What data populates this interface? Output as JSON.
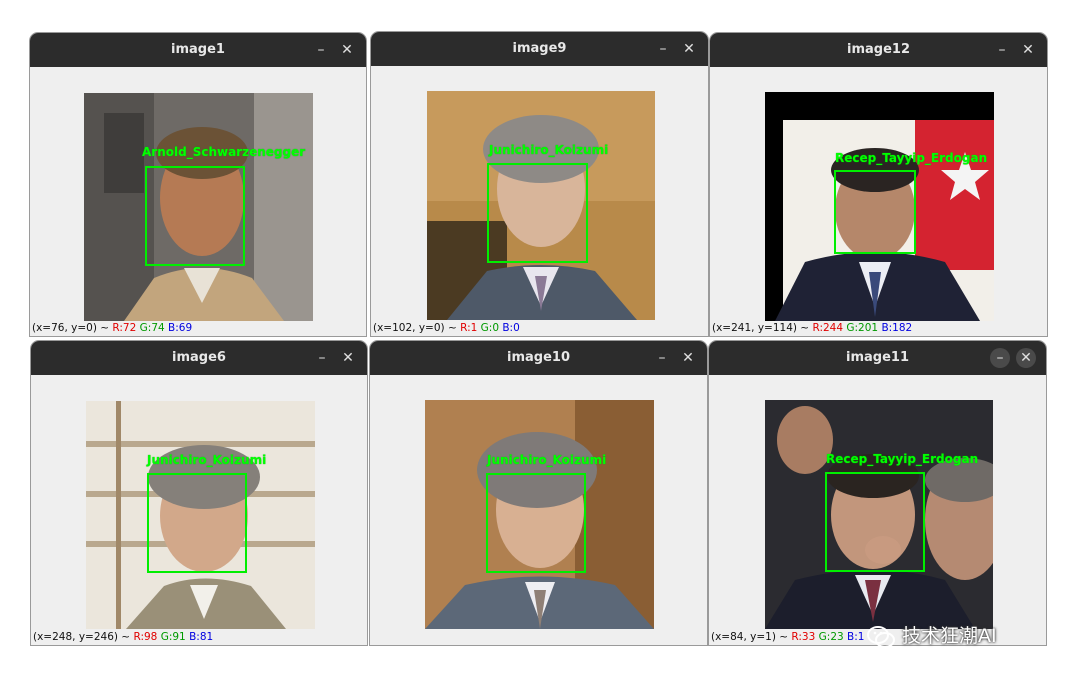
{
  "windows": [
    {
      "title": "image1",
      "name_label": "Arnold_Schwarzenegger",
      "status": {
        "coords": "(x=76, y=0) ~",
        "r": "R:72",
        "g": "G:74",
        "b": "B:69"
      }
    },
    {
      "title": "image9",
      "name_label": "Junichiro_Koizumi",
      "status": {
        "coords": "(x=102, y=0) ~",
        "r": "R:1",
        "g": "G:0",
        "b": "B:0"
      }
    },
    {
      "title": "image12",
      "name_label": "Recep_Tayyip_Erdogan",
      "status": {
        "coords": "(x=241, y=114) ~",
        "r": "R:244",
        "g": "G:201",
        "b": "B:182"
      }
    },
    {
      "title": "image6",
      "name_label": "Junichiro_Koizumi",
      "status": {
        "coords": "(x=248, y=246) ~",
        "r": "R:98",
        "g": "G:91",
        "b": "B:81"
      }
    },
    {
      "title": "image10",
      "name_label": "Junichiro_Koizumi",
      "status": {
        "coords": "",
        "r": "",
        "g": "",
        "b": ""
      }
    },
    {
      "title": "image11",
      "name_label": "Recep_Tayyip_Erdogan",
      "status": {
        "coords": "(x=84, y=1) ~",
        "r": "R:33",
        "g": "G:23",
        "b": "B:1"
      }
    }
  ],
  "window_controls": {
    "minimize": "–",
    "close": "✕"
  },
  "watermark": {
    "text": "技术狂潮AI",
    "icon": "wechat-icon"
  },
  "colors": {
    "titlebar": "#2c2c2c",
    "face_box": "#00ee00",
    "label": "#00ff00"
  }
}
